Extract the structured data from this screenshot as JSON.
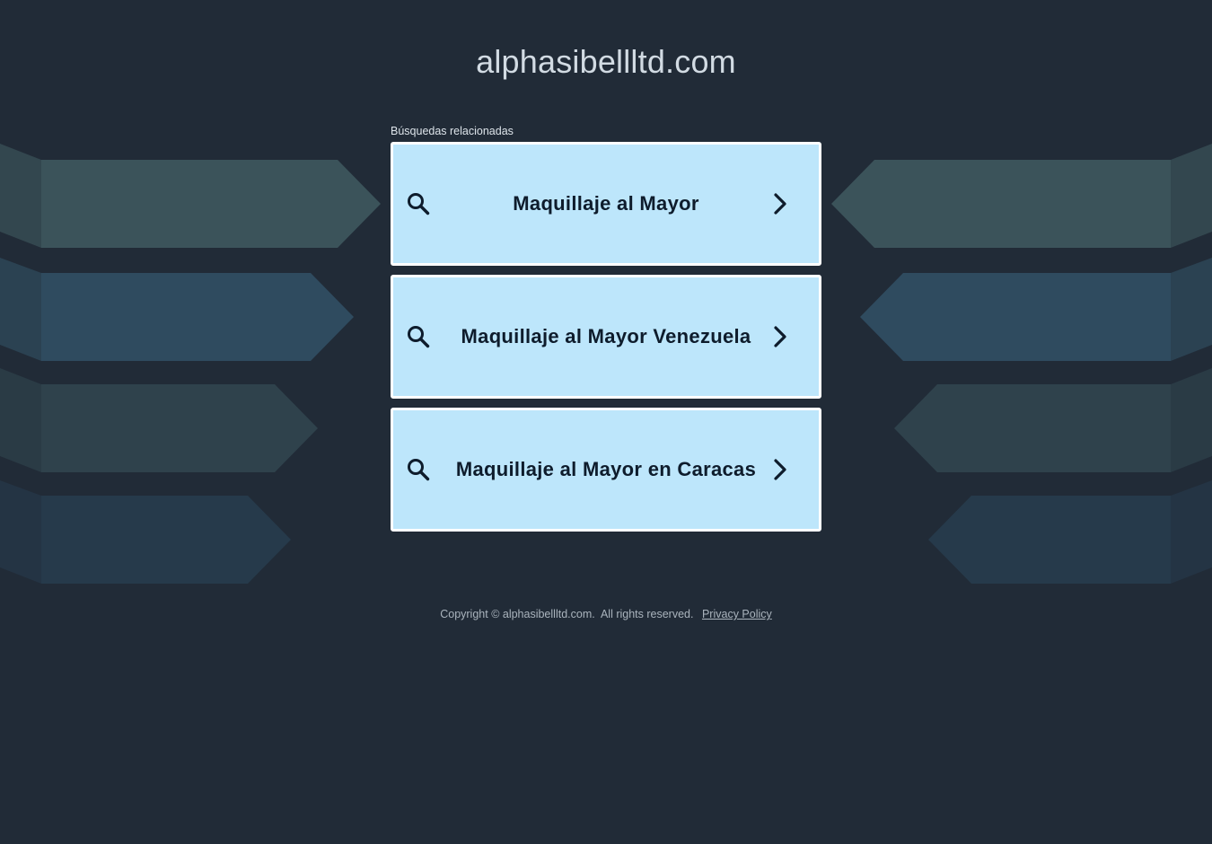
{
  "site": {
    "domain": "alphasibellltd.com"
  },
  "related": {
    "label": "Búsquedas relacionadas",
    "items": [
      {
        "label": "Maquillaje al Mayor"
      },
      {
        "label": "Maquillaje al Mayor Venezuela"
      },
      {
        "label": "Maquillaje al Mayor en Caracas"
      }
    ]
  },
  "footer": {
    "copyright": "Copyright © alphasibellltd.com.  All rights reserved.",
    "privacy_label": "Privacy Policy"
  },
  "colors": {
    "background": "#212b37",
    "card_background": "#bde6fb",
    "card_border": "#ffffff",
    "card_text": "#0e1c2c",
    "title_text": "#d2dbe3"
  },
  "icons": {
    "card_left": "search-icon",
    "card_right": "chevron-right-icon"
  }
}
